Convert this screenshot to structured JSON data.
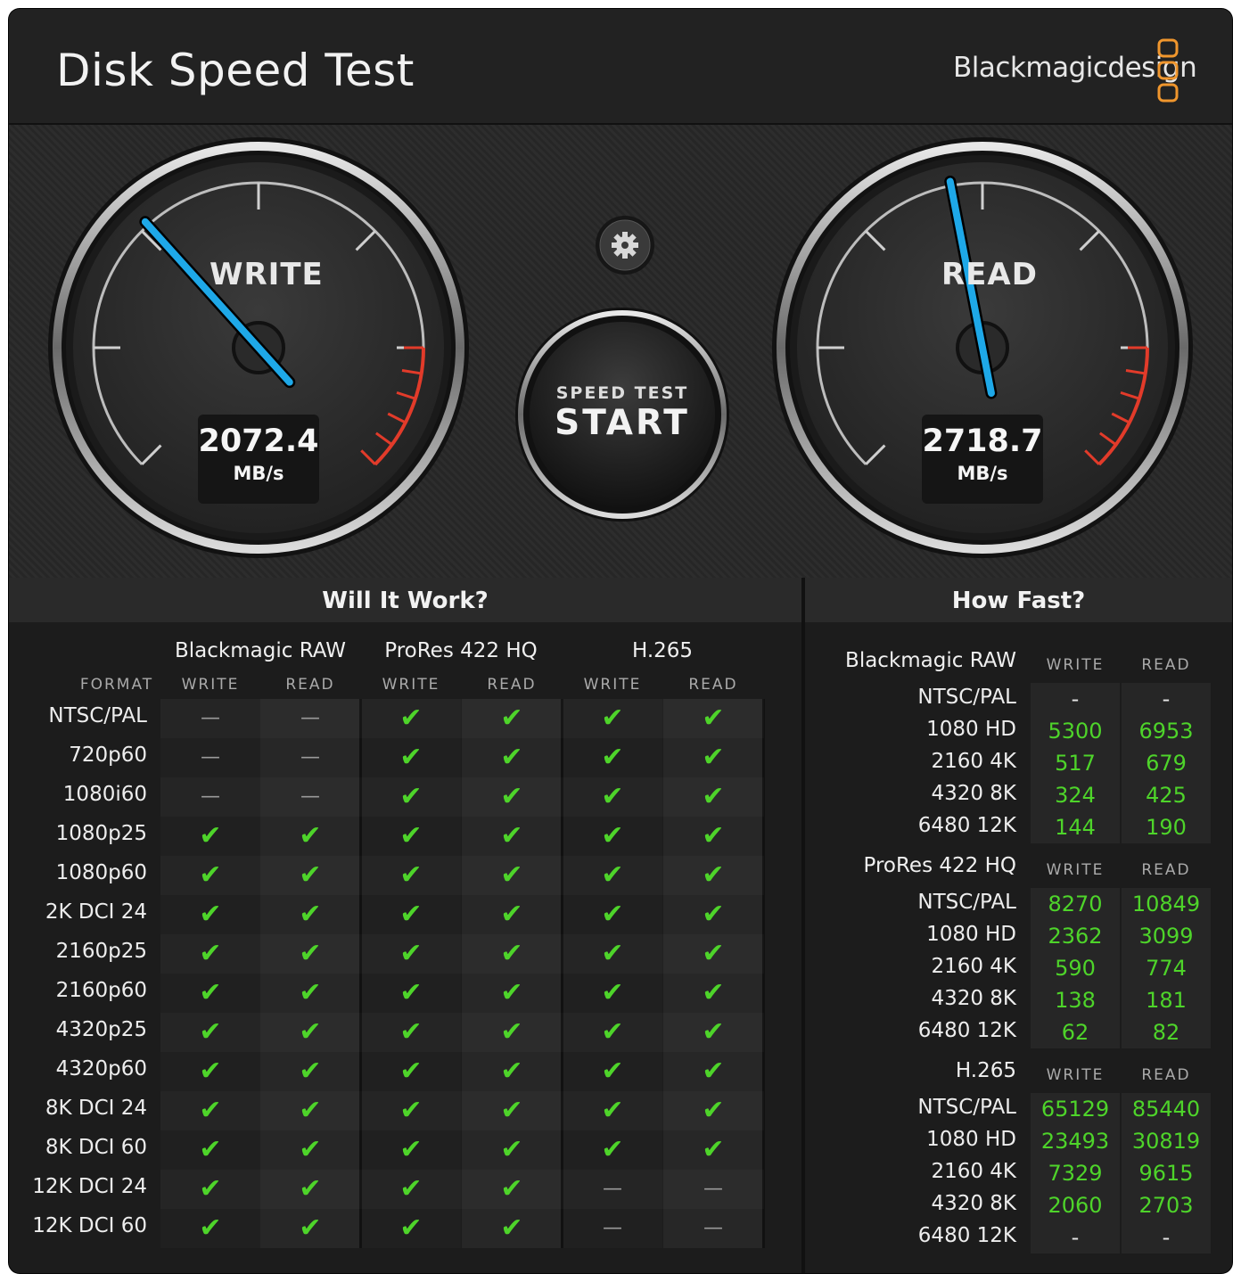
{
  "window": {
    "title": "Disk Speed Test",
    "brand": "Blackmagicdesign",
    "close_glyph": "✕",
    "brand_accent": "#f0962d"
  },
  "gauges": {
    "write": {
      "label": "WRITE",
      "value": "2072.4",
      "unit": "MB/s",
      "needle_color": "#1ea8e8"
    },
    "read": {
      "label": "READ",
      "value": "2718.7",
      "unit": "MB/s",
      "needle_color": "#1ea8e8"
    },
    "settings_icon": "gear-icon",
    "start": {
      "small": "SPEED TEST",
      "big": "START"
    }
  },
  "will_it_work": {
    "title": "Will It Work?",
    "format_header": "FORMAT",
    "codecs": [
      "Blackmagic RAW",
      "ProRes 422 HQ",
      "H.265"
    ],
    "sub_headers": [
      "WRITE",
      "READ"
    ],
    "rows": [
      {
        "format": "NTSC/PAL",
        "cells": [
          "no",
          "no",
          "ok",
          "ok",
          "ok",
          "ok"
        ]
      },
      {
        "format": "720p60",
        "cells": [
          "no",
          "no",
          "ok",
          "ok",
          "ok",
          "ok"
        ]
      },
      {
        "format": "1080i60",
        "cells": [
          "no",
          "no",
          "ok",
          "ok",
          "ok",
          "ok"
        ]
      },
      {
        "format": "1080p25",
        "cells": [
          "ok",
          "ok",
          "ok",
          "ok",
          "ok",
          "ok"
        ]
      },
      {
        "format": "1080p60",
        "cells": [
          "ok",
          "ok",
          "ok",
          "ok",
          "ok",
          "ok"
        ]
      },
      {
        "format": "2K DCI 24",
        "cells": [
          "ok",
          "ok",
          "ok",
          "ok",
          "ok",
          "ok"
        ]
      },
      {
        "format": "2160p25",
        "cells": [
          "ok",
          "ok",
          "ok",
          "ok",
          "ok",
          "ok"
        ]
      },
      {
        "format": "2160p60",
        "cells": [
          "ok",
          "ok",
          "ok",
          "ok",
          "ok",
          "ok"
        ]
      },
      {
        "format": "4320p25",
        "cells": [
          "ok",
          "ok",
          "ok",
          "ok",
          "ok",
          "ok"
        ]
      },
      {
        "format": "4320p60",
        "cells": [
          "ok",
          "ok",
          "ok",
          "ok",
          "ok",
          "ok"
        ]
      },
      {
        "format": "8K DCI 24",
        "cells": [
          "ok",
          "ok",
          "ok",
          "ok",
          "ok",
          "ok"
        ]
      },
      {
        "format": "8K DCI 60",
        "cells": [
          "ok",
          "ok",
          "ok",
          "ok",
          "ok",
          "ok"
        ]
      },
      {
        "format": "12K DCI 24",
        "cells": [
          "ok",
          "ok",
          "ok",
          "ok",
          "no",
          "no"
        ]
      },
      {
        "format": "12K DCI 60",
        "cells": [
          "ok",
          "ok",
          "ok",
          "ok",
          "no",
          "no"
        ]
      }
    ],
    "ok_glyph": "✔",
    "no_glyph": "—"
  },
  "how_fast": {
    "title": "How Fast?",
    "write_header": "WRITE",
    "read_header": "READ",
    "groups": [
      {
        "codec": "Blackmagic RAW",
        "rows": [
          {
            "res": "NTSC/PAL",
            "write": "-",
            "read": "-"
          },
          {
            "res": "1080 HD",
            "write": "5300",
            "read": "6953"
          },
          {
            "res": "2160 4K",
            "write": "517",
            "read": "679"
          },
          {
            "res": "4320 8K",
            "write": "324",
            "read": "425"
          },
          {
            "res": "6480 12K",
            "write": "144",
            "read": "190"
          }
        ]
      },
      {
        "codec": "ProRes 422 HQ",
        "rows": [
          {
            "res": "NTSC/PAL",
            "write": "8270",
            "read": "10849"
          },
          {
            "res": "1080 HD",
            "write": "2362",
            "read": "3099"
          },
          {
            "res": "2160 4K",
            "write": "590",
            "read": "774"
          },
          {
            "res": "4320 8K",
            "write": "138",
            "read": "181"
          },
          {
            "res": "6480 12K",
            "write": "62",
            "read": "82"
          }
        ]
      },
      {
        "codec": "H.265",
        "rows": [
          {
            "res": "NTSC/PAL",
            "write": "65129",
            "read": "85440"
          },
          {
            "res": "1080 HD",
            "write": "23493",
            "read": "30819"
          },
          {
            "res": "2160 4K",
            "write": "7329",
            "read": "9615"
          },
          {
            "res": "4320 8K",
            "write": "2060",
            "read": "2703"
          },
          {
            "res": "6480 12K",
            "write": "-",
            "read": "-"
          }
        ]
      }
    ]
  }
}
